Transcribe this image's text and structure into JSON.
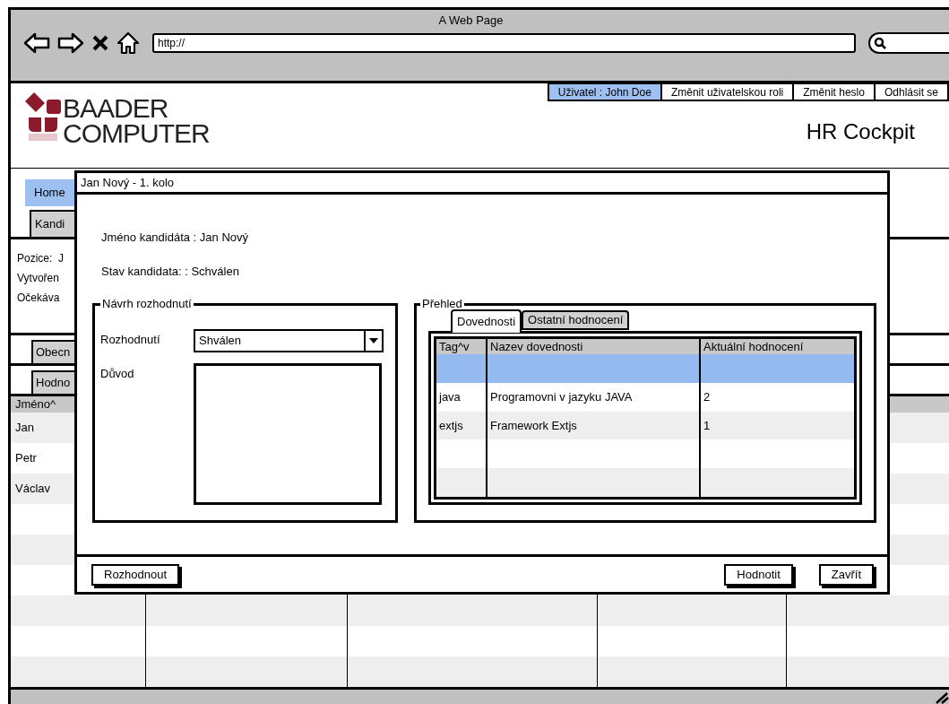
{
  "browser": {
    "title": "A Web Page",
    "url": "http://"
  },
  "header": {
    "logo": [
      "BAADER",
      "COMPUTER"
    ],
    "user_links": [
      {
        "label": "Uživatel : John Doe",
        "selected": true
      },
      {
        "label": "Změnit uživatelskou roli",
        "selected": false
      },
      {
        "label": "Změnit heslo",
        "selected": false
      },
      {
        "label": "Odhlásit se",
        "selected": false
      }
    ],
    "app_title": "HR Cockpit"
  },
  "background": {
    "tabs": [
      {
        "label": "Home",
        "selected": true
      },
      {
        "label": "Kandi",
        "selected": false
      }
    ],
    "details": [
      "Pozice:  J",
      "Vytvořen",
      "Očekáva"
    ],
    "subtabs": [
      "Obecn",
      "Hodno"
    ],
    "grid": {
      "column_1": "Jméno^",
      "rows": [
        "Jan",
        "Petr",
        "Václav"
      ]
    }
  },
  "dialog": {
    "title": "Jan Nový - 1. kolo",
    "info": [
      "Jméno kandidáta : Jan Nový",
      "Stav kandidata: : Schválen"
    ],
    "decision": {
      "legend": "Návrh rozhodnutí",
      "select_label": "Rozhodnutí",
      "select_value": "Shválen",
      "reason_label": "Důvod"
    },
    "overview": {
      "legend": "Přehled",
      "tabs": [
        {
          "label": "Dovednosti",
          "selected": true
        },
        {
          "label": "Ostatní hodnocení",
          "selected": false
        }
      ],
      "table": {
        "columns": [
          "Tag^v",
          "Nazev dovednosti",
          "Aktuální hodnocení"
        ],
        "rows": [
          {
            "selected": true,
            "cells": []
          },
          {
            "selected": false,
            "cells": [
              "java",
              "Programovni v jazyku JAVA",
              "2"
            ]
          },
          {
            "selected": false,
            "cells": [
              "extjs",
              "Framework Extjs",
              "1"
            ]
          }
        ]
      }
    },
    "buttons_left": [
      "Rozhodnout"
    ],
    "buttons_right": [
      "Hodnotit",
      "Zavřít"
    ]
  }
}
